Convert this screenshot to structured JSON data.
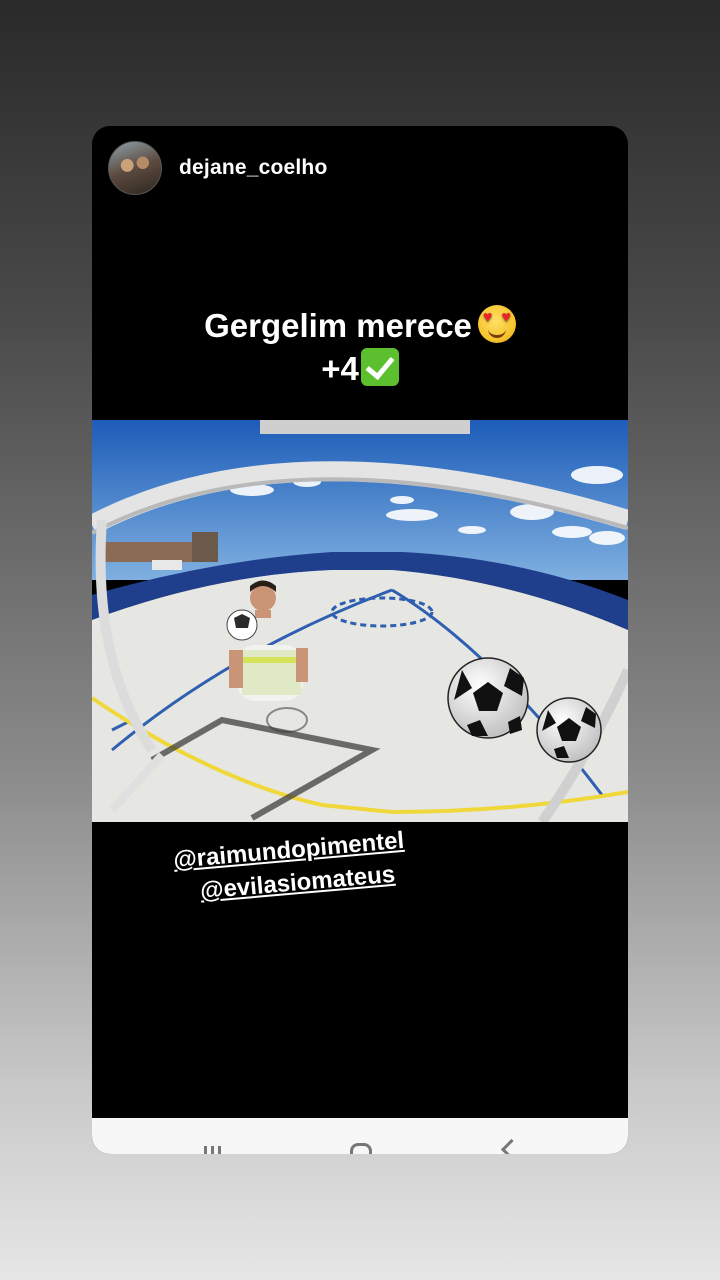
{
  "story": {
    "username": "dejane_coelho",
    "caption_line1": "Gergelim merece",
    "caption_line2": "+4",
    "caption_emoji1": "heart-eyes-emoji",
    "caption_emoji2": "check-mark-emoji",
    "mentions": [
      "@raimundopimentel",
      "@evilasiomateus"
    ]
  },
  "colors": {
    "card_bg": "#000000",
    "court": "#e6e6e2",
    "court_line_blue": "#2f5fb0",
    "court_line_yellow": "#f0d83a",
    "sky": "#2e6fc4",
    "wall": "#1f3f8c"
  },
  "navbar": {
    "icons": [
      "recent-apps-icon",
      "home-icon",
      "back-icon"
    ]
  }
}
